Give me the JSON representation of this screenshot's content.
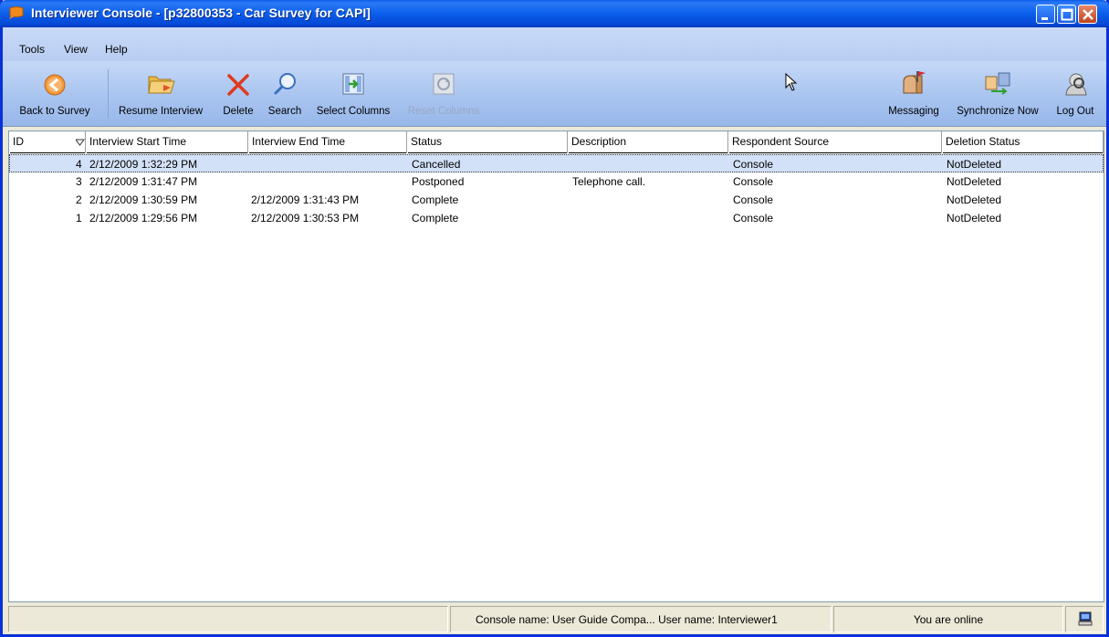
{
  "window": {
    "title": "Interviewer Console - [p32800353 - Car Survey for CAPI]"
  },
  "menu": [
    "Tools",
    "View",
    "Help"
  ],
  "toolbar": {
    "back": "Back to Survey",
    "resume": "Resume Interview",
    "delete": "Delete",
    "search": "Search",
    "select_columns": "Select Columns",
    "reset_columns": "Reset Columns",
    "messaging": "Messaging",
    "synchronize": "Synchronize Now",
    "logout": "Log Out"
  },
  "table": {
    "columns": [
      "ID",
      "Interview Start Time",
      "Interview End Time",
      "Status",
      "Description",
      "Respondent Source",
      "Deletion Status"
    ],
    "rows": [
      [
        "4",
        "2/12/2009 1:32:29 PM",
        "",
        "Cancelled",
        "",
        "Console",
        "NotDeleted"
      ],
      [
        "3",
        "2/12/2009 1:31:47 PM",
        "",
        "Postponed",
        "Telephone call.",
        "Console",
        "NotDeleted"
      ],
      [
        "2",
        "2/12/2009 1:30:59 PM",
        "2/12/2009 1:31:43 PM",
        "Complete",
        "",
        "Console",
        "NotDeleted"
      ],
      [
        "1",
        "2/12/2009 1:29:56 PM",
        "2/12/2009 1:30:53 PM",
        "Complete",
        "",
        "Console",
        "NotDeleted"
      ]
    ]
  },
  "status": {
    "console_user": "Console name:  User Guide Compa...   User name: Interviewer1",
    "online": "You are online"
  }
}
